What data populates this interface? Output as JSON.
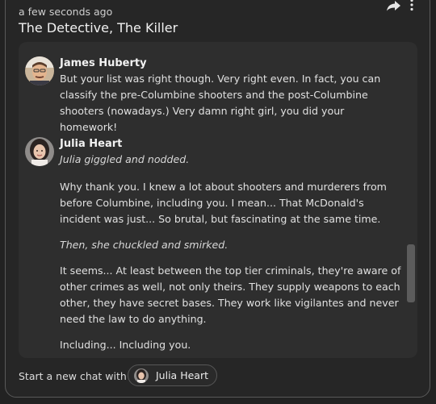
{
  "post": {
    "timestamp": "a few seconds ago",
    "title": "The Detective, The Killer"
  },
  "icons": {
    "share": "share-arrow-icon",
    "more": "more-vertical-icon"
  },
  "messages": [
    {
      "author": "James Huberty",
      "avatar": "avatar-james-huberty",
      "paragraphs": [
        {
          "text": "But your list was right though. Very right even. In fact, you can classify the pre-Columbine shooters and the post-Columbine shooters (nowadays.) Very damn right girl, you did your homework!",
          "style": "normal"
        }
      ]
    },
    {
      "author": "Julia Heart",
      "avatar": "avatar-julia-heart",
      "paragraphs": [
        {
          "text": "Julia giggled and nodded.",
          "style": "action"
        },
        {
          "text": "Why thank you. I knew a lot about shooters and murderers from before Columbine, including you. I mean... That McDonald's incident was just... So brutal, but fascinating at the same time.",
          "style": "normal"
        },
        {
          "text": "Then, she chuckled and smirked.",
          "style": "action"
        },
        {
          "text": "It seems... At least between the top tier criminals, they're aware of other crimes as well, not only theirs. They supply weapons to each other, they have secret bases. They work like vigilantes and never need the law to do anything.",
          "style": "normal"
        },
        {
          "text": "Including... Including you.",
          "style": "normal"
        }
      ]
    }
  ],
  "footer": {
    "label": "Start a new chat with",
    "character_name": "Julia Heart"
  },
  "colors": {
    "background": "#222222",
    "panel": "#2e2e2e",
    "border": "#5a5a5a"
  }
}
